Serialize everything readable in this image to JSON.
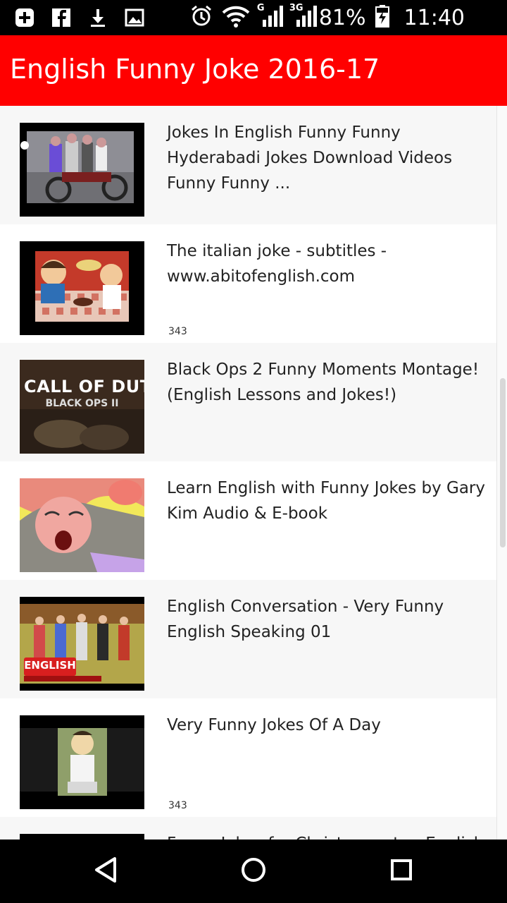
{
  "status_bar": {
    "left_icons": [
      "add-box-icon",
      "facebook-icon",
      "download-icon",
      "image-icon"
    ],
    "right_icons": [
      "alarm-icon",
      "wifi-icon",
      "signal-icon",
      "signal-3g-icon",
      "battery-charging-icon"
    ],
    "signal_g_label": "G",
    "signal_3g_label": "3G",
    "battery": "81%",
    "time": "11:40"
  },
  "appbar": {
    "title": "English Funny Joke 2016-17"
  },
  "list": {
    "items": [
      {
        "title": "Jokes In English Funny Funny Hyderabadi Jokes Download Videos Funny Funny ...",
        "count": ""
      },
      {
        "title": "The italian joke - subtitles - www.abitofenglish.com",
        "count": "343"
      },
      {
        "title": "Black Ops 2 Funny Moments Montage! (English Lessons and Jokes!)",
        "count": ""
      },
      {
        "title": "Learn English with Funny Jokes by Gary Kim Audio & E-book",
        "count": ""
      },
      {
        "title": "English Conversation - Very Funny English Speaking 01",
        "count": ""
      },
      {
        "title": "Very Funny Jokes Of A Day",
        "count": "343"
      },
      {
        "title": "Funny Jokes for Christmas - to - English",
        "count": ""
      }
    ],
    "thumbs": [
      {
        "caption": ""
      },
      {
        "caption": ""
      },
      {
        "caption": "CALL OF DUTY",
        "sub": "BLACK OPS II"
      },
      {
        "caption": ""
      },
      {
        "caption": "ENGLISH"
      },
      {
        "caption": ""
      },
      {
        "caption": ""
      }
    ]
  },
  "navbar": {
    "buttons": [
      "back-icon",
      "home-icon",
      "recents-icon"
    ]
  },
  "colors": {
    "accent": "#ff0000",
    "list_alt_bg": "#f7f7f7",
    "text": "#222222"
  }
}
